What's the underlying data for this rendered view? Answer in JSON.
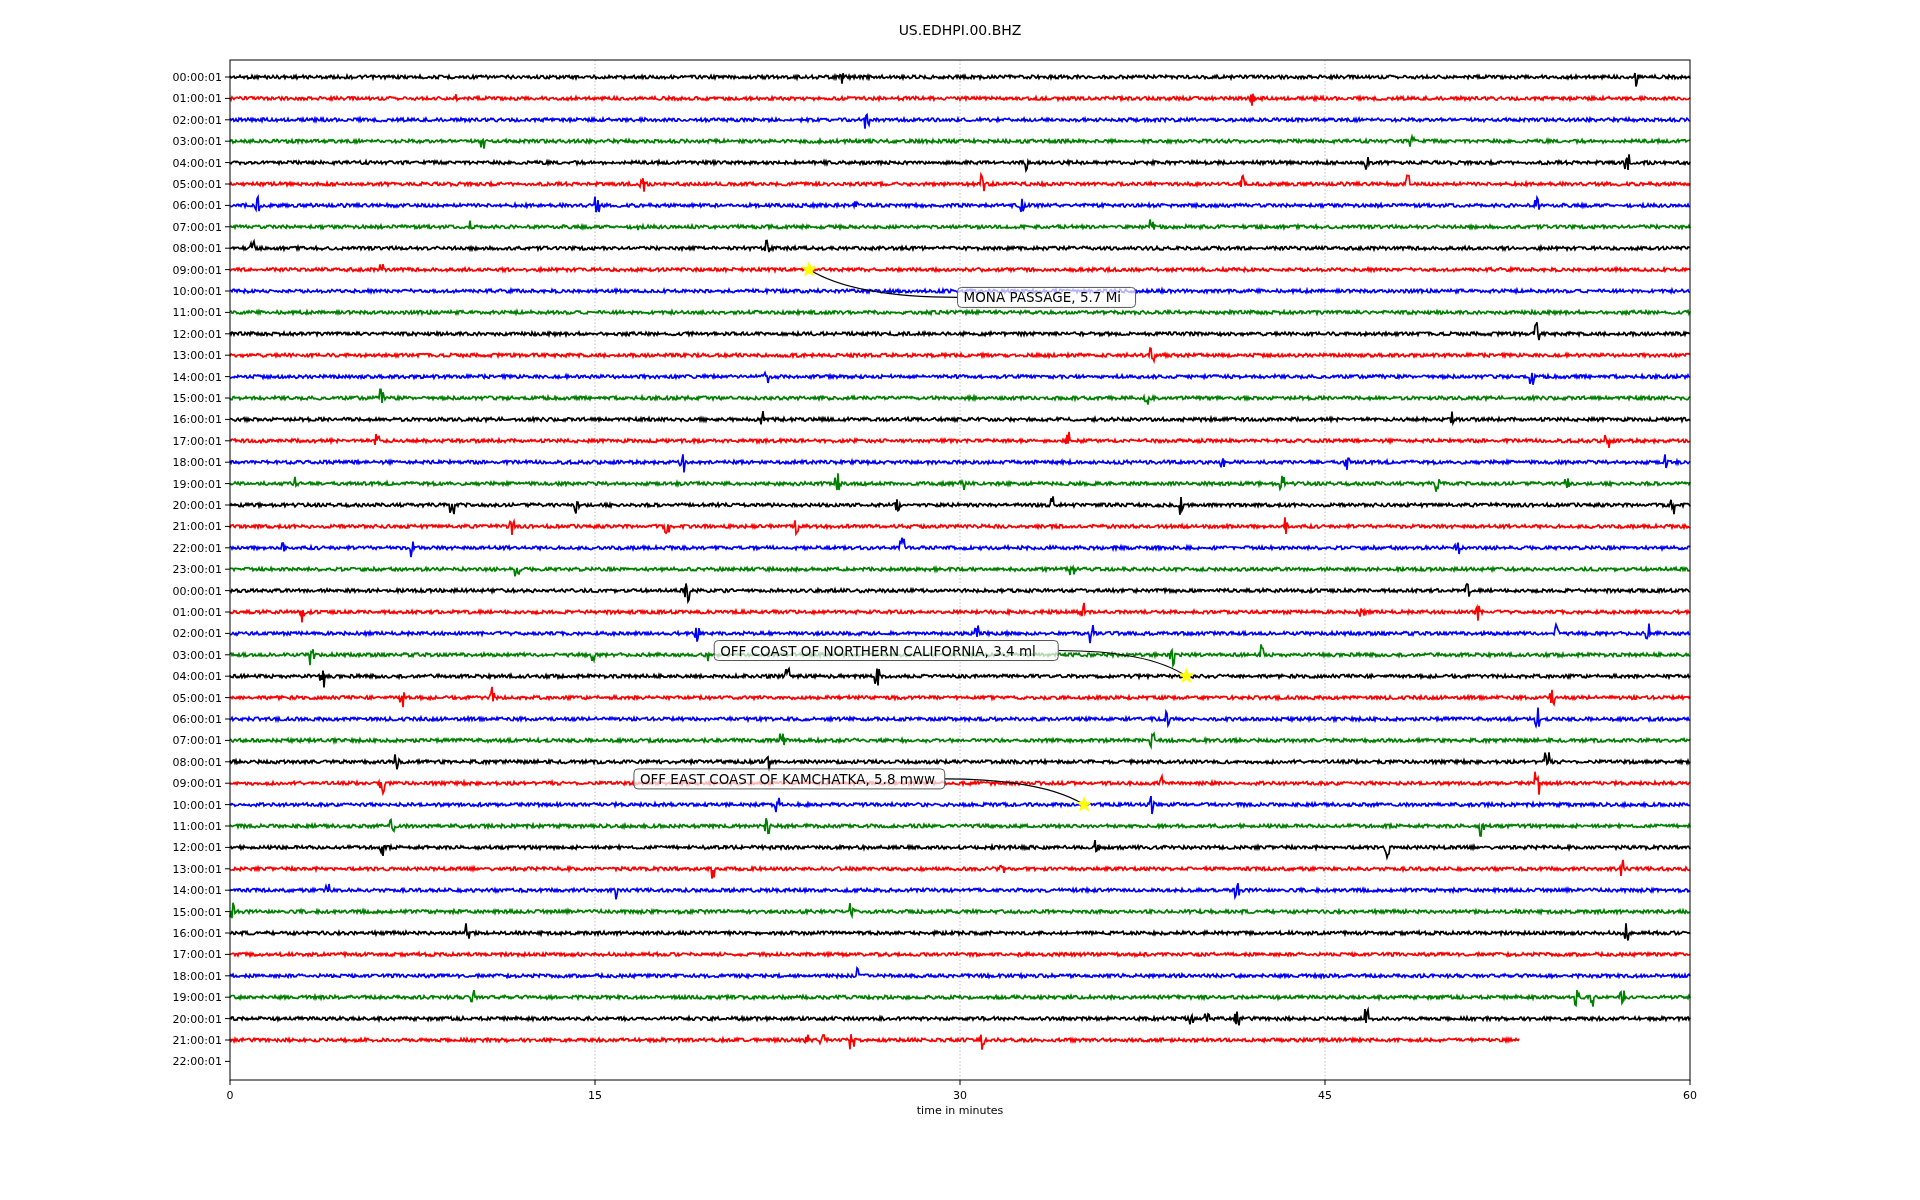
{
  "figure": {
    "title": "US.EDHPI.00.BHZ",
    "x_axis": {
      "ticks": [
        "0",
        "15",
        "30",
        "45",
        "60"
      ],
      "label": "time in minutes"
    },
    "rows": [
      {
        "label": "00:00:01",
        "color": "#000000",
        "kind": "full"
      },
      {
        "label": "01:00:01",
        "color": "#ff0000",
        "kind": "full"
      },
      {
        "label": "02:00:01",
        "color": "#0000ff",
        "kind": "full"
      },
      {
        "label": "03:00:01",
        "color": "#008000",
        "kind": "full"
      },
      {
        "label": "04:00:01",
        "color": "#000000",
        "kind": "full"
      },
      {
        "label": "05:00:01",
        "color": "#ff0000",
        "kind": "full"
      },
      {
        "label": "06:00:01",
        "color": "#0000ff",
        "kind": "full"
      },
      {
        "label": "07:00:01",
        "color": "#008000",
        "kind": "full"
      },
      {
        "label": "08:00:01",
        "color": "#000000",
        "kind": "full"
      },
      {
        "label": "09:00:01",
        "color": "#ff0000",
        "kind": "full",
        "event": {
          "label": "MONA PASSAGE, 5.7 Mi"
        }
      },
      {
        "label": "10:00:01",
        "color": "#0000ff",
        "kind": "full"
      },
      {
        "label": "11:00:01",
        "color": "#008000",
        "kind": "full"
      },
      {
        "label": "12:00:01",
        "color": "#000000",
        "kind": "full"
      },
      {
        "label": "13:00:01",
        "color": "#ff0000",
        "kind": "full"
      },
      {
        "label": "14:00:01",
        "color": "#0000ff",
        "kind": "full"
      },
      {
        "label": "15:00:01",
        "color": "#008000",
        "kind": "full"
      },
      {
        "label": "16:00:01",
        "color": "#000000",
        "kind": "full"
      },
      {
        "label": "17:00:01",
        "color": "#ff0000",
        "kind": "full"
      },
      {
        "label": "18:00:01",
        "color": "#0000ff",
        "kind": "full"
      },
      {
        "label": "19:00:01",
        "color": "#008000",
        "kind": "full"
      },
      {
        "label": "20:00:01",
        "color": "#000000",
        "kind": "full"
      },
      {
        "label": "21:00:01",
        "color": "#ff0000",
        "kind": "full"
      },
      {
        "label": "22:00:01",
        "color": "#0000ff",
        "kind": "full"
      },
      {
        "label": "23:00:01",
        "color": "#008000",
        "kind": "full"
      },
      {
        "label": "00:00:01",
        "color": "#000000",
        "kind": "full"
      },
      {
        "label": "01:00:01",
        "color": "#ff0000",
        "kind": "full"
      },
      {
        "label": "02:00:01",
        "color": "#0000ff",
        "kind": "full"
      },
      {
        "label": "03:00:01",
        "color": "#008000",
        "kind": "full"
      },
      {
        "label": "04:00:01",
        "color": "#000000",
        "kind": "full",
        "event": {
          "label": "OFF COAST OF NORTHERN CALIFORNIA, 3.4 ml"
        }
      },
      {
        "label": "05:00:01",
        "color": "#ff0000",
        "kind": "full"
      },
      {
        "label": "06:00:01",
        "color": "#0000ff",
        "kind": "full"
      },
      {
        "label": "07:00:01",
        "color": "#008000",
        "kind": "full"
      },
      {
        "label": "08:00:01",
        "color": "#000000",
        "kind": "full"
      },
      {
        "label": "09:00:01",
        "color": "#ff0000",
        "kind": "full"
      },
      {
        "label": "10:00:01",
        "color": "#0000ff",
        "kind": "full",
        "event": {
          "label": "OFF EAST COAST OF KAMCHATKA, 5.8 mww"
        }
      },
      {
        "label": "11:00:01",
        "color": "#008000",
        "kind": "full"
      },
      {
        "label": "12:00:01",
        "color": "#000000",
        "kind": "full"
      },
      {
        "label": "13:00:01",
        "color": "#ff0000",
        "kind": "full"
      },
      {
        "label": "14:00:01",
        "color": "#0000ff",
        "kind": "full"
      },
      {
        "label": "15:00:01",
        "color": "#008000",
        "kind": "full"
      },
      {
        "label": "16:00:01",
        "color": "#000000",
        "kind": "full"
      },
      {
        "label": "17:00:01",
        "color": "#ff0000",
        "kind": "full"
      },
      {
        "label": "18:00:01",
        "color": "#0000ff",
        "kind": "full"
      },
      {
        "label": "19:00:01",
        "color": "#008000",
        "kind": "full"
      },
      {
        "label": "20:00:01",
        "color": "#000000",
        "kind": "full"
      },
      {
        "label": "21:00:01",
        "color": "#ff0000",
        "kind": "partial"
      },
      {
        "label": "22:00:01",
        "kind": "empty"
      }
    ]
  }
}
